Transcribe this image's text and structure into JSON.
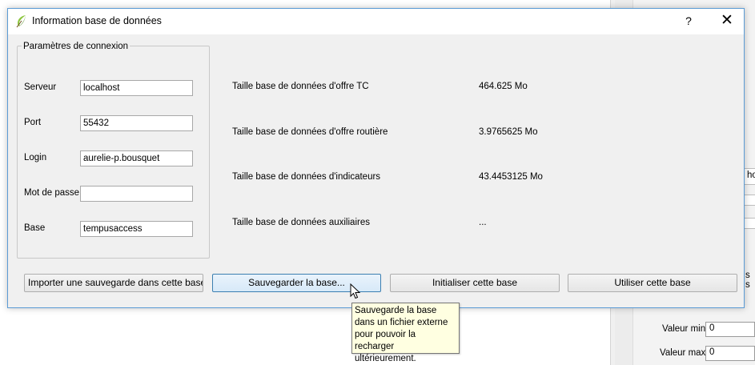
{
  "window": {
    "title": "Information base de données",
    "help_glyph": "?",
    "close_glyph": "✕"
  },
  "connection": {
    "group_title": "Paramètres de connexion",
    "fields": [
      {
        "label": "Serveur",
        "value": "localhost"
      },
      {
        "label": "Port",
        "value": "55432"
      },
      {
        "label": "Login",
        "value": "aurelie-p.bousquet"
      },
      {
        "label": "Mot de passe",
        "value": ""
      },
      {
        "label": "Base",
        "value": "tempusaccess"
      }
    ]
  },
  "sizes": [
    {
      "label": "Taille base de données d'offre TC",
      "value": "464.625 Mo"
    },
    {
      "label": "Taille base de données d'offre routière",
      "value": "3.9765625 Mo"
    },
    {
      "label": "Taille base de données d'indicateurs",
      "value": "43.4453125 Mo"
    },
    {
      "label": "Taille base de données auxiliaires",
      "value": "..."
    }
  ],
  "buttons": {
    "import": "Importer une sauvegarde dans cette base...",
    "save": "Sauvegarder la base...",
    "init": "Initialiser cette base",
    "use": "Utiliser cette base"
  },
  "tooltip": {
    "text": "Sauvegarde la base dans un fichier externe pour pouvoir la recharger ultérieurement."
  },
  "background_app": {
    "fragment_top": "ho",
    "fragment_side": "s s",
    "min_label": "Valeur min",
    "min_value": "0",
    "max_label": "Valeur max",
    "max_value": "0"
  },
  "colors": {
    "dialog_border": "#5b9bd5",
    "tooltip_bg": "#ffffe1",
    "focused_button_border": "#3c7fb1"
  }
}
